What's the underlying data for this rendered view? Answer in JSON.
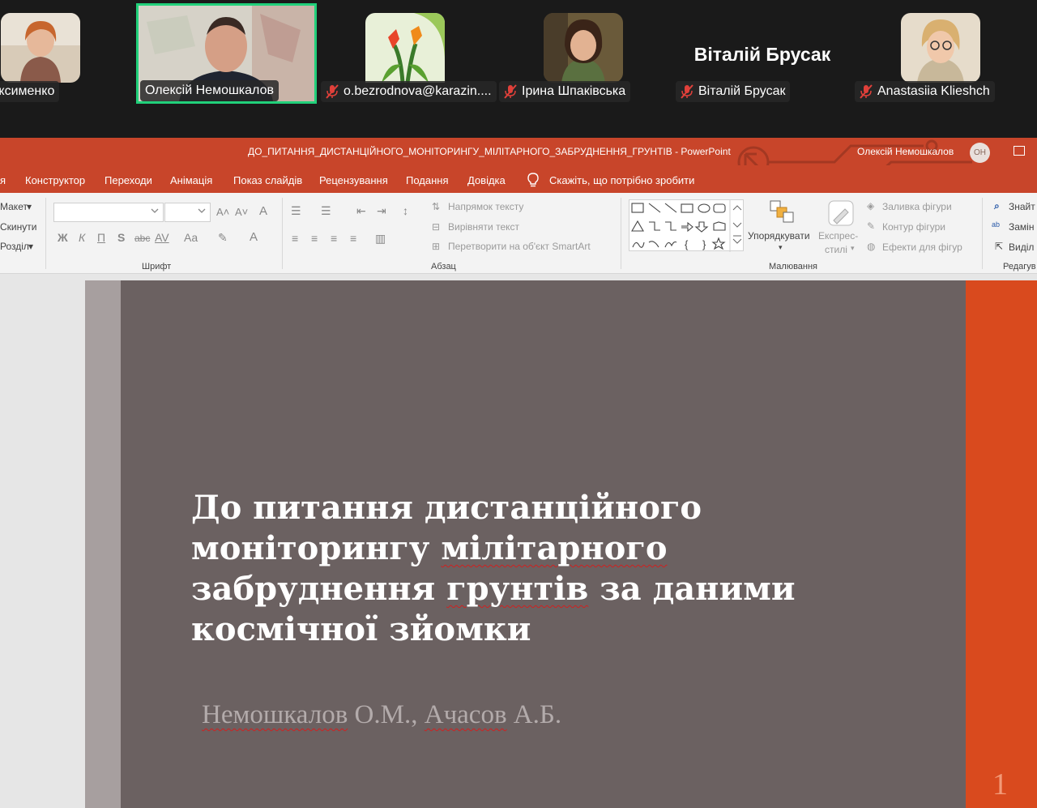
{
  "participants": [
    {
      "name": "дія Максименко",
      "muted": false,
      "speaking": false
    },
    {
      "name": "Олексій Немошкалов",
      "muted": false,
      "speaking": true
    },
    {
      "name": "o.bezrodnova@karazin....",
      "muted": true,
      "speaking": false
    },
    {
      "name": "Ірина Шпаківська",
      "muted": true,
      "speaking": false
    },
    {
      "name": "Віталій Брусак",
      "tile_text": "Віталій Брусак",
      "muted": true,
      "speaking": false
    },
    {
      "name": "Anastasiia Klieshch",
      "muted": true,
      "speaking": false
    }
  ],
  "powerpoint": {
    "document_title": "ДО_ПИТАННЯ_ДИСТАНЦІЙНОГО_МОНІТОРИНГУ_МІЛІТАРНОГО_ЗАБРУДНЕННЯ_ГРУНТІВ  -  PowerPoint",
    "user_name": "Олексій Немошкалов",
    "user_initials": "ОН",
    "accent_color": "#c8452a",
    "tabs": [
      {
        "id": "partial",
        "label": "я"
      },
      {
        "id": "design",
        "label": "Конструктор"
      },
      {
        "id": "transitions",
        "label": "Переходи"
      },
      {
        "id": "animations",
        "label": "Анімація"
      },
      {
        "id": "slideshow",
        "label": "Показ слайдів"
      },
      {
        "id": "review",
        "label": "Рецензування"
      },
      {
        "id": "view",
        "label": "Подання"
      },
      {
        "id": "help",
        "label": "Довідка"
      }
    ],
    "tell_me": "Скажіть, що потрібно зробити",
    "ribbon": {
      "slides_group": {
        "layout": "Макет",
        "reset": "Скинути",
        "section": "Розділ"
      },
      "font_group": {
        "label": "Шрифт",
        "bold": "Ж",
        "italic": "К",
        "underline": "П",
        "shadow": "S",
        "strike": "abc",
        "spacing": "AV",
        "case": "Aa",
        "grow": "A˄",
        "shrink": "A˅",
        "clear": "A",
        "color": "A"
      },
      "paragraph_group": {
        "label": "Абзац",
        "text_direction": "Напрямок тексту",
        "align_text": "Вирівняти текст",
        "smartart": "Перетворити на об'єкт SmartArt"
      },
      "drawing_group": {
        "label": "Малювання",
        "arrange": "Упорядкувати",
        "quick_styles_1": "Експрес-",
        "quick_styles_2": "стилі",
        "shape_fill": "Заливка фігури",
        "shape_outline": "Контур фігури",
        "shape_effects": "Ефекти для фігур"
      },
      "editing_group": {
        "label": "Редагув",
        "find": "Знайт",
        "replace": "Замін",
        "select": "Виділ"
      }
    },
    "slide": {
      "title_lines": [
        "До питання дистанційного",
        "моніторингу",
        "мілітарного",
        "забруднення",
        "грунтів",
        "за даними",
        "космічної зйомки"
      ],
      "author_1": "Немошкалов",
      "author_1_initials": " О.М., ",
      "author_2": "Ачасов",
      "author_2_initials": " А.Б.",
      "number": "1",
      "background_color": "#6b6161",
      "accent_color": "#d94a1e"
    }
  }
}
